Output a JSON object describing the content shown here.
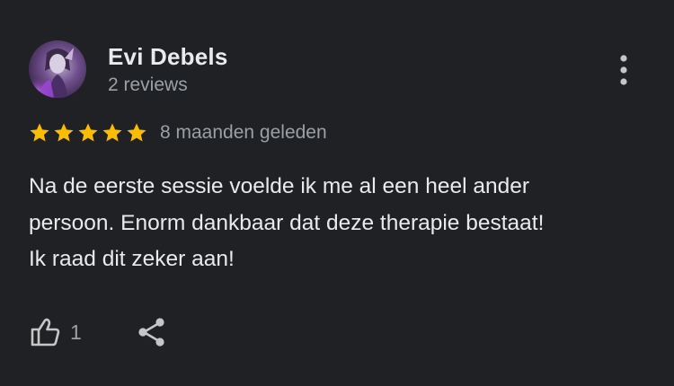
{
  "review": {
    "author": {
      "name": "Evi Debels",
      "meta": "2 reviews",
      "avatar_icon": "user-avatar-photo"
    },
    "rating": 5,
    "rating_max": 5,
    "date": "8 maanden geleden",
    "text_lines": [
      "Na de eerste sessie voelde ik me al een heel ander",
      "persoon. Enorm dankbaar dat deze therapie bestaat!",
      "Ik raad dit zeker aan!"
    ],
    "likes": "1"
  },
  "icons": {
    "menu": "more-vertical-icon",
    "like": "thumbs-up-icon",
    "share": "share-icon",
    "star": "star-icon"
  },
  "colors": {
    "background": "#202124",
    "text_primary": "#e8eaed",
    "text_secondary": "#9aa0a6",
    "star": "#fbbc04"
  }
}
